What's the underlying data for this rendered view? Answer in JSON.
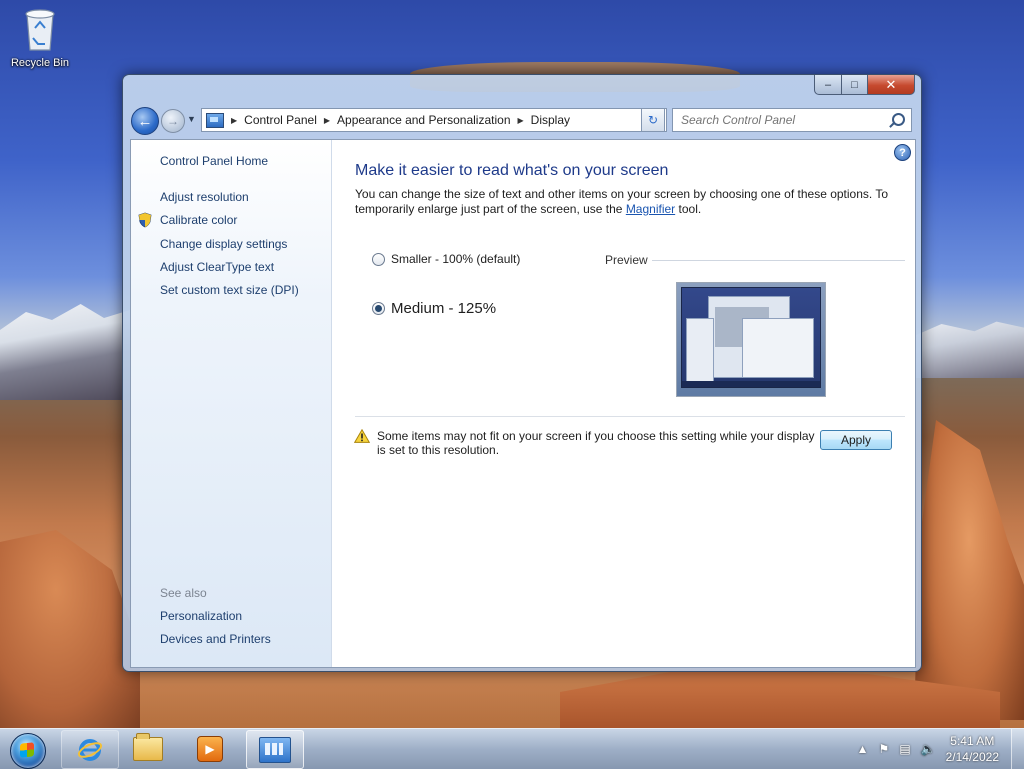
{
  "desktop": {
    "icons": [
      {
        "label": "Recycle Bin",
        "icon": "recycle-bin-icon"
      }
    ]
  },
  "window": {
    "caption_buttons": {
      "minimize": "–",
      "maximize": "□",
      "close": "✕"
    },
    "address": {
      "breadcrumbs": [
        "Control Panel",
        "Appearance and Personalization",
        "Display"
      ]
    },
    "search": {
      "placeholder": "Search Control Panel"
    },
    "sidebar": {
      "home": "Control Panel Home",
      "links": [
        "Adjust resolution",
        "Calibrate color",
        "Change display settings",
        "Adjust ClearType text",
        "Set custom text size (DPI)"
      ],
      "see_also_label": "See also",
      "see_also": [
        "Personalization",
        "Devices and Printers"
      ]
    },
    "main": {
      "heading": "Make it easier to read what's on your screen",
      "description_prefix": "You can change the size of text and other items on your screen by choosing one of these options. To temporarily enlarge just part of the screen, use the ",
      "description_link": "Magnifier",
      "description_suffix": " tool.",
      "options": [
        {
          "label": "Smaller - 100% (default)",
          "selected": false
        },
        {
          "label": "Medium - 125%",
          "selected": true
        }
      ],
      "preview_label": "Preview",
      "warning": "Some items may not fit on your screen if you choose this setting while your display is set to this resolution.",
      "apply_label": "Apply"
    }
  },
  "taskbar": {
    "apps": [
      "internet-explorer-icon",
      "windows-explorer-icon",
      "media-player-icon",
      "control-panel-icon"
    ],
    "clock": {
      "time": "5:41 AM",
      "date": "2/14/2022"
    }
  }
}
